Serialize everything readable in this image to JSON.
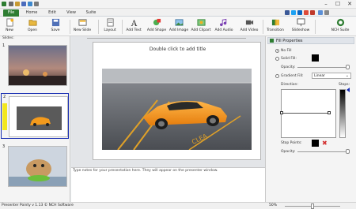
{
  "menu": {
    "tabs": [
      "File",
      "Home",
      "Edit",
      "View",
      "Suite"
    ]
  },
  "toolbar": {
    "items": [
      {
        "label": "New"
      },
      {
        "label": "Open"
      },
      {
        "label": "Save"
      },
      {
        "label": "New Slide"
      },
      {
        "label": "Layout"
      },
      {
        "label": "Add Text"
      },
      {
        "label": "Add Shape"
      },
      {
        "label": "Add Image"
      },
      {
        "label": "Add Clipart"
      },
      {
        "label": "Add Audio"
      },
      {
        "label": "Add Video"
      },
      {
        "label": "Transition"
      },
      {
        "label": "Slideshow"
      },
      {
        "label": "NCH Suite"
      }
    ]
  },
  "slides_panel": {
    "title": "Slides:",
    "slide_numbers": [
      "1",
      "2",
      "3"
    ]
  },
  "slide": {
    "title_placeholder": "Double click to add title"
  },
  "notes": {
    "placeholder": "Type notes for your presentation here. They will appear on the presenter window."
  },
  "properties": {
    "title": "Fill Properties",
    "no_fill": "No Fill",
    "solid_fill": "Solid Fill:",
    "opacity": "Opacity:",
    "gradient_fill": "Gradient Fill:",
    "gradient_type": "Linear",
    "direction": "Direction:",
    "stops": "Stops:",
    "stop_points": "Stop Points:",
    "opacity2": "Opacity:"
  },
  "status": {
    "text": "Presenter Pointy v 1.13 © NCH Software",
    "zoom": "50%"
  },
  "colors": {
    "file_tab": "#2e7d32",
    "selection": "#1a2fb3",
    "car_orange": "#f39a1c"
  }
}
